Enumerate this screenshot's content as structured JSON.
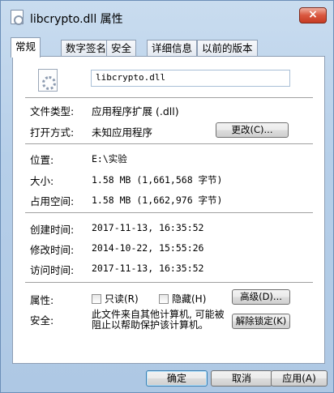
{
  "window": {
    "title": "libcrypto.dll 属性",
    "close_label": "×"
  },
  "tabs": [
    "常规",
    "数字签名",
    "安全",
    "详细信息",
    "以前的版本"
  ],
  "general": {
    "filename": "libcrypto.dll",
    "file_type_label": "文件类型:",
    "file_type_value": "应用程序扩展 (.dll)",
    "opens_with_label": "打开方式:",
    "opens_with_value": "未知应用程序",
    "change_button": "更改(C)...",
    "location_label": "位置:",
    "location_value": "E:\\实验",
    "size_label": "大小:",
    "size_value": "1.58 MB (1,661,568 字节)",
    "size_on_disk_label": "占用空间:",
    "size_on_disk_value": "1.58 MB (1,662,976 字节)",
    "created_label": "创建时间:",
    "created_value": "2017-11-13, 16:35:52",
    "modified_label": "修改时间:",
    "modified_value": "2014-10-22, 15:55:26",
    "accessed_label": "访问时间:",
    "accessed_value": "2017-11-13, 16:35:52",
    "attributes_label": "属性:",
    "readonly_label": "只读(R)",
    "hidden_label": "隐藏(H)",
    "advanced_button": "高级(D)...",
    "security_label": "安全:",
    "security_text": "此文件来自其他计算机, 可能被阻止以帮助保护该计算机。",
    "unblock_button": "解除锁定(K)"
  },
  "footer": {
    "ok_button": "确定",
    "cancel_button": "取消",
    "apply_button": "应用(A)"
  }
}
